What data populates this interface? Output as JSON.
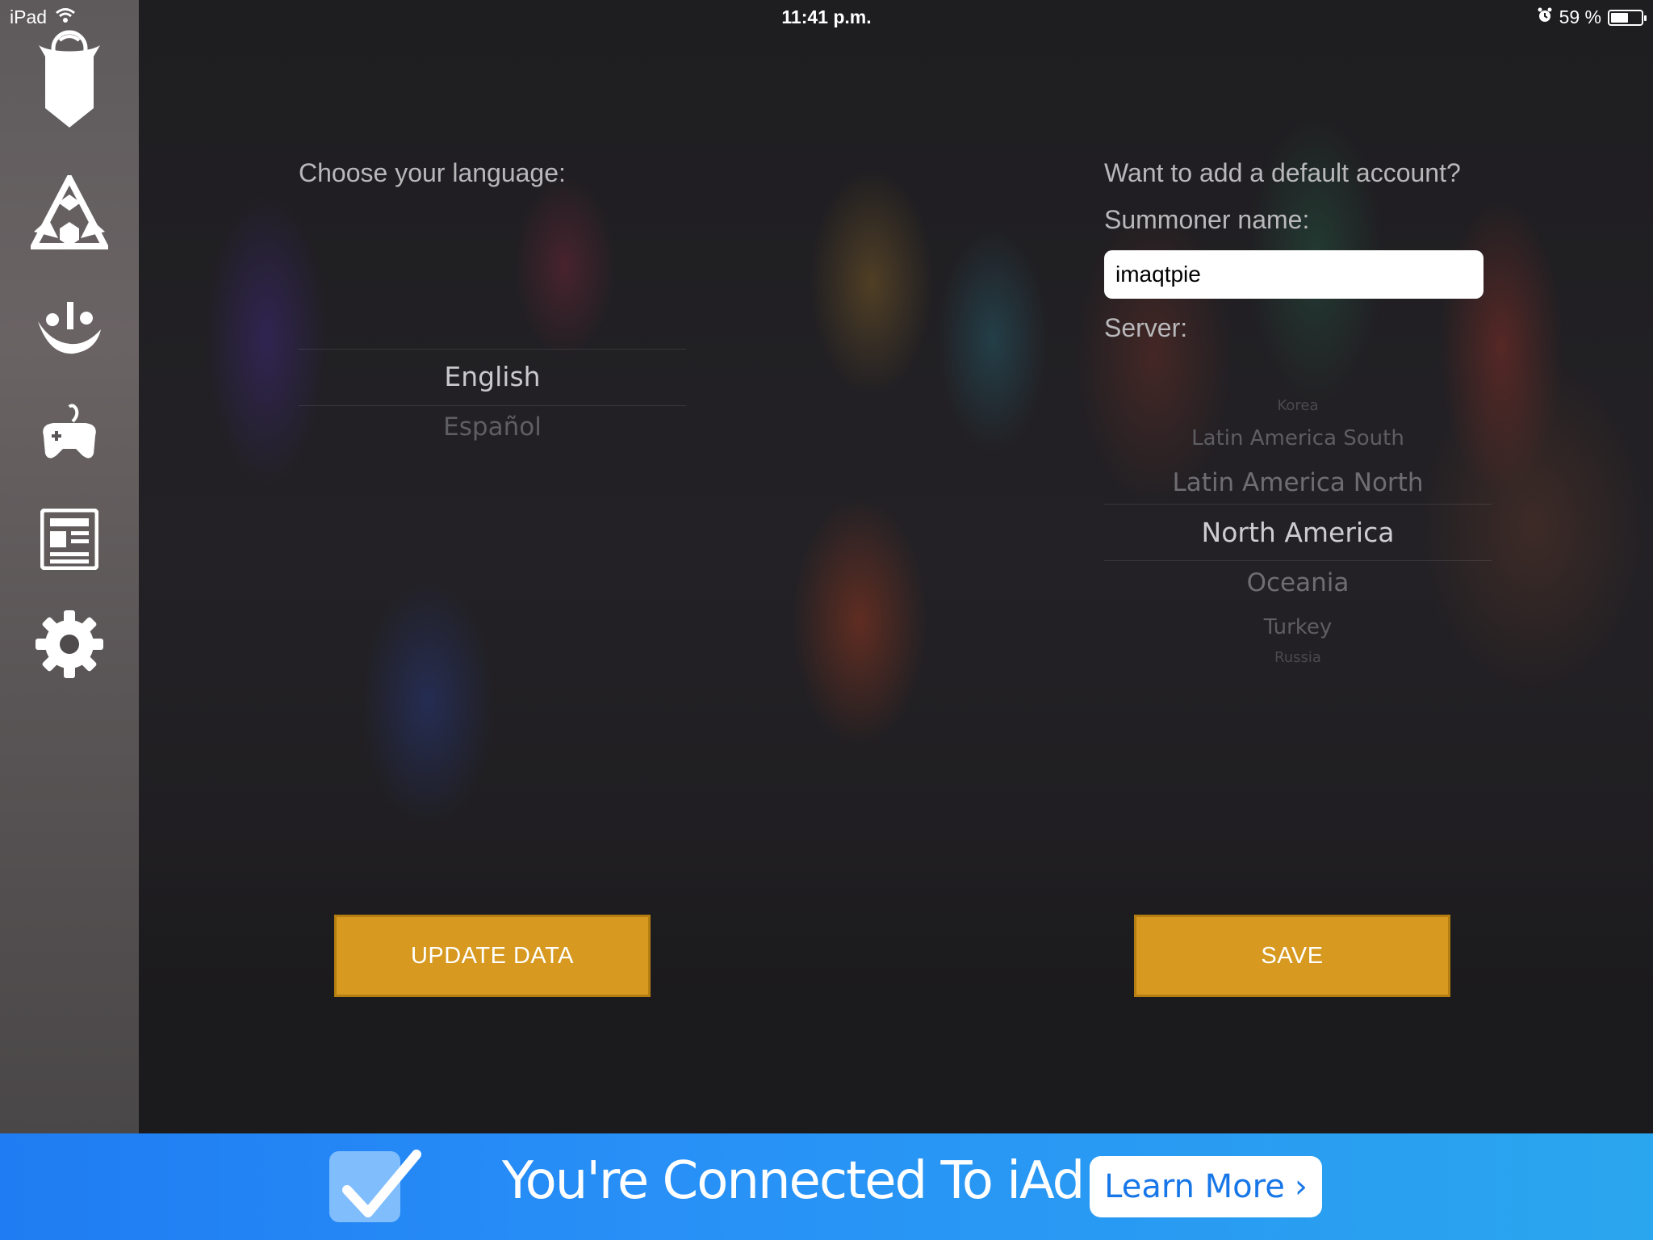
{
  "status_bar": {
    "device": "iPad",
    "time": "11:41 p.m.",
    "battery": "59 %",
    "battery_level": 0.59
  },
  "sidebar": {
    "items": [
      {
        "name": "champion-icon"
      },
      {
        "name": "items-icon"
      },
      {
        "name": "summoner-icon"
      },
      {
        "name": "game-controller-icon"
      },
      {
        "name": "news-icon"
      },
      {
        "name": "gear-icon"
      }
    ]
  },
  "language": {
    "title": "Choose your language:",
    "options": [
      "English",
      "Español"
    ],
    "selected": "English"
  },
  "account": {
    "title": "Want to add a default account?",
    "summoner_label": "Summoner name:",
    "summoner_value": "imaqtpie",
    "server_label": "Server:",
    "server_options": [
      "Korea",
      "Latin America South",
      "Latin America North",
      "North America",
      "Oceania",
      "Turkey",
      "Russia"
    ],
    "selected_server": "North America"
  },
  "buttons": {
    "update": "UPDATE DATA",
    "save": "SAVE"
  },
  "ad": {
    "text": "You're Connected To iAd",
    "button": "Learn More",
    "button_chevron": "›"
  },
  "colors": {
    "accent_button": "#d7991f",
    "ad_blue": "#1f7cf2"
  }
}
